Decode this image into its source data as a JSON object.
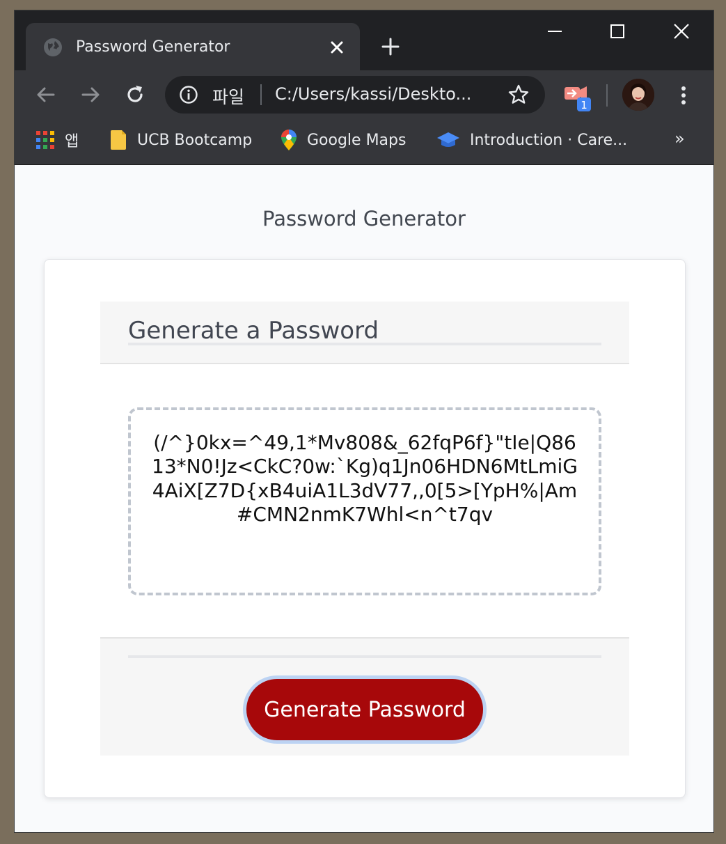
{
  "browser": {
    "tab_title": "Password Generator",
    "omnibox": {
      "scheme_label": "파일",
      "url": "C:/Users/kassi/Deskto..."
    },
    "extension_badge": "1",
    "bookmarks": [
      {
        "label": "앱",
        "icon": "apps-grid-icon"
      },
      {
        "label": "UCB Bootcamp",
        "icon": "folder-icon"
      },
      {
        "label": "Google Maps",
        "icon": "maps-pin-icon"
      },
      {
        "label": "Introduction · Care...",
        "icon": "cap-icon"
      }
    ],
    "bookmarks_overflow": "»"
  },
  "page": {
    "heading": "Password Generator",
    "card": {
      "title": "Generate a Password",
      "password": "(/^}0kx=^49,1*Mv808&_62fqP6f}\"tIe|Q8613*N0!Jz<CkC?0w:`Kg)q1Jn06HDN6MtLmiG4AiX[Z7D{xB4uiA1L3dV77,,0[5>[YpH%|Am#CMN2nmK7Whl<n^t7qv",
      "button_label": "Generate Password"
    }
  },
  "colors": {
    "button_bg": "#a7080a",
    "button_focus_ring": "#bcd3f3",
    "chrome_dark": "#202124",
    "chrome_toolbar": "#35363a"
  }
}
